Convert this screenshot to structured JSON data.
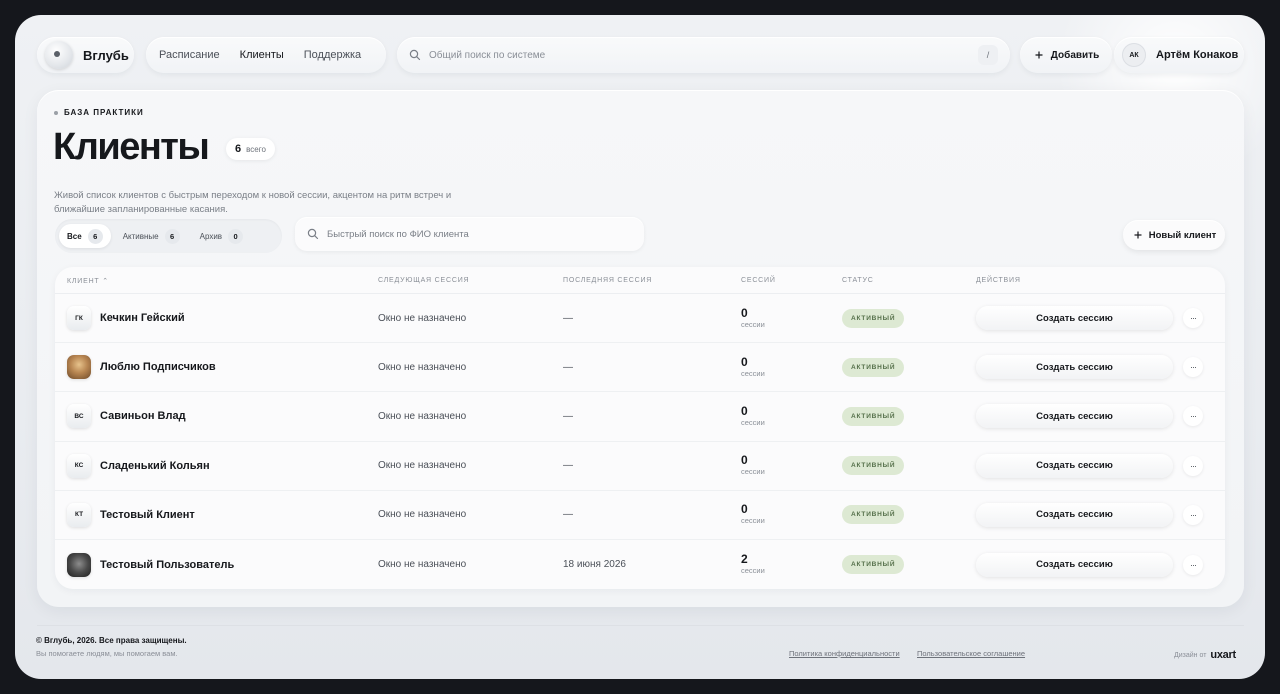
{
  "brand": {
    "name": "Вглубь"
  },
  "nav": {
    "items": [
      {
        "label": "Расписание"
      },
      {
        "label": "Клиенты"
      },
      {
        "label": "Поддержка"
      }
    ]
  },
  "search": {
    "placeholder": "Общий поиск по системе",
    "shortcut": "/"
  },
  "header": {
    "add_label": "Добавить"
  },
  "user": {
    "initials": "АК",
    "name": "Артём Конаков"
  },
  "page": {
    "eyebrow": "БАЗА ПРАКТИКИ",
    "title": "Клиенты",
    "count": "6",
    "count_label": "всего",
    "description": "Живой список клиентов с быстрым переходом к новой сессии, акцентом на ритм встреч и ближайшие запланированные касания."
  },
  "filters": [
    {
      "label": "Все",
      "count": "6"
    },
    {
      "label": "Активные",
      "count": "6"
    },
    {
      "label": "Архив",
      "count": "0"
    }
  ],
  "client_search": {
    "placeholder": "Быстрый поиск по ФИО клиента"
  },
  "new_client_label": "Новый клиент",
  "table": {
    "columns": {
      "client": "КЛИЕНТ",
      "next": "СЛЕДУЮЩАЯ СЕССИЯ",
      "last": "ПОСЛЕДНЯЯ СЕССИЯ",
      "sessions": "СЕССИЙ",
      "status": "СТАТУС",
      "actions": "ДЕЙСТВИЯ"
    },
    "sessions_unit": "сессии",
    "action_label": "Создать сессию",
    "more_label": "···",
    "rows": [
      {
        "initials": "ГК",
        "name": "Кечкин Гейский",
        "next": "Окно не назначено",
        "last": "—",
        "sessions": "0",
        "status": "АКТИВНЫЙ"
      },
      {
        "initials": "",
        "name": "Люблю Подписчиков",
        "next": "Окно не назначено",
        "last": "—",
        "sessions": "0",
        "status": "АКТИВНЫЙ"
      },
      {
        "initials": "ВС",
        "name": "Савиньон Влад",
        "next": "Окно не назначено",
        "last": "—",
        "sessions": "0",
        "status": "АКТИВНЫЙ"
      },
      {
        "initials": "КС",
        "name": "Сладенький Кольян",
        "next": "Окно не назначено",
        "last": "—",
        "sessions": "0",
        "status": "АКТИВНЫЙ"
      },
      {
        "initials": "КТ",
        "name": "Тестовый Клиент",
        "next": "Окно не назначено",
        "last": "—",
        "sessions": "0",
        "status": "АКТИВНЫЙ"
      },
      {
        "initials": "",
        "name": "Тестовый Пользователь",
        "next": "Окно не назначено",
        "last": "18 июня 2026",
        "sessions": "2",
        "status": "АКТИВНЫЙ"
      }
    ]
  },
  "footer": {
    "copyright": "© Вглубь, 2026. Все права защищены.",
    "motto": "Вы помогаете людям, мы помогаем вам.",
    "privacy": "Политика конфиденциальности",
    "terms": "Пользовательское соглашение",
    "design_by": "Дизайн от",
    "design_brand": "uxart"
  },
  "colors": {
    "status_bg": "#dde9d3",
    "status_text": "#55704a",
    "accent": "#16181c"
  }
}
